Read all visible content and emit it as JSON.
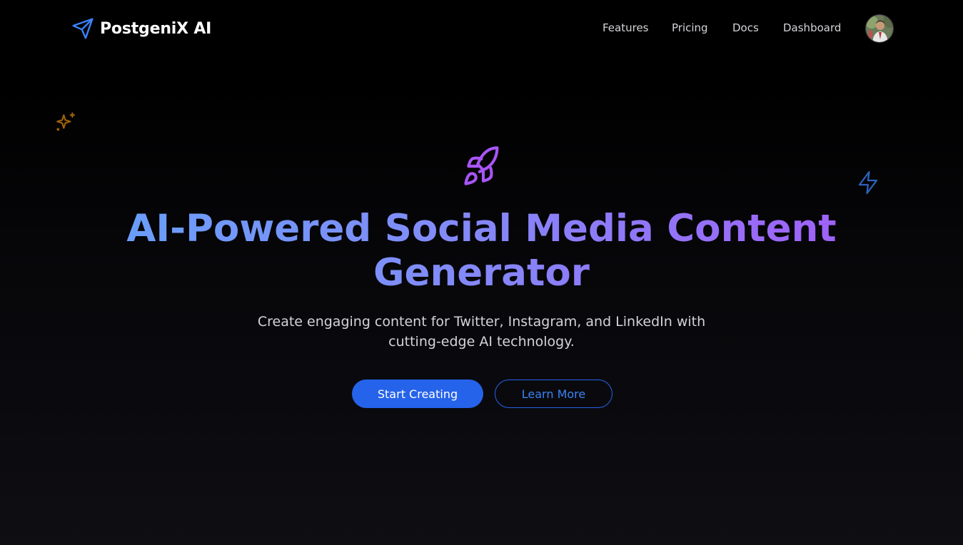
{
  "brand": {
    "name": "PostgeniX AI",
    "icon": "paper-plane-icon",
    "accent": "#3b82f6"
  },
  "nav": {
    "items": [
      {
        "label": "Features"
      },
      {
        "label": "Pricing"
      },
      {
        "label": "Docs"
      },
      {
        "label": "Dashboard"
      }
    ],
    "avatar": "user-avatar"
  },
  "decorations": {
    "sparkles": {
      "icon": "sparkles-icon",
      "color": "#a16207"
    },
    "rocket": {
      "icon": "rocket-icon",
      "color": "#a855f7"
    },
    "zap": {
      "icon": "zap-icon",
      "color": "#3b82f6"
    }
  },
  "hero": {
    "title": "AI-Powered Social Media Content Generator",
    "subtitle": "Create engaging content for Twitter, Instagram, and LinkedIn with cutting-edge AI technology.",
    "primary_cta": "Start Creating",
    "secondary_cta": "Learn More",
    "gradient": [
      "#60a5fa",
      "#818cf8",
      "#a855f7"
    ]
  },
  "colors": {
    "background": "#000000",
    "primary_button": "#2563eb",
    "nav_text": "#d4d4d8"
  }
}
